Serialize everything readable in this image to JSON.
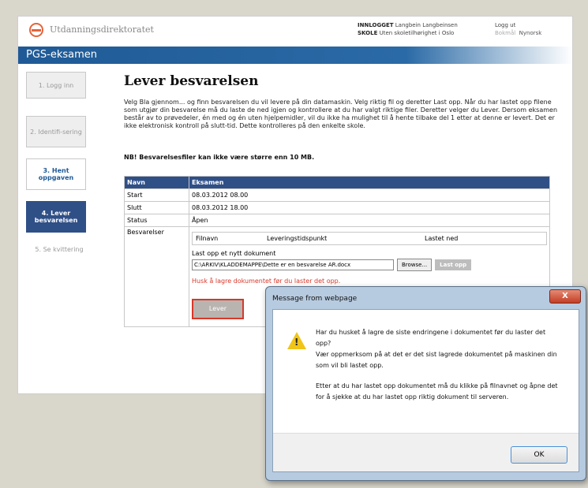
{
  "header": {
    "logo_text": "Utdanningsdirektoratet",
    "logged_in_label": "INNLOGGET",
    "logged_in_user": "Langbein Langbeinsen",
    "school_label": "SKOLE",
    "school_value": "Uten skoletilhørighet i Oslo",
    "logout_link": "Logg ut",
    "bokmal_link": "Bokmål",
    "nynorsk_link": "Nynorsk"
  },
  "banner": {
    "title": "PGS-eksamen"
  },
  "steps": [
    {
      "label": "1. Logg inn"
    },
    {
      "label": "2. Identifi-sering"
    },
    {
      "label": "3. Hent oppgaven"
    },
    {
      "label": "4. Lever besvarelsen"
    },
    {
      "label": "5. Se kvittering"
    }
  ],
  "main": {
    "title": "Lever besvarelsen",
    "intro": "Velg Bla gjennom... og finn besvarelsen du vil levere på din datamaskin. Velg riktig fil og deretter Last opp. Når du har lastet opp filene som utgjør din besvarelse må du laste de ned igjen og kontrollere at du har valgt riktige filer. Deretter velger du Lever. Dersom eksamen består av to prøvedeler, én med og én uten hjelpemidler, vil du ikke ha mulighet til å hente tilbake del 1 etter at denne er levert. Det er ikke elektronisk kontroll på slutt-tid. Dette kontrolleres på den enkelte skole.",
    "nb_warning": "NB! Besvarelsesfiler kan ikke være større enn 10 MB.",
    "table": {
      "header_col1": "Navn",
      "header_col2": "Eksamen",
      "rows": [
        {
          "label": "Start",
          "value": "08.03.2012 08.00"
        },
        {
          "label": "Slutt",
          "value": "08.03.2012 18.00"
        },
        {
          "label": "Status",
          "value": "Åpen"
        }
      ],
      "answers_label": "Besvarelser",
      "subtable_headers": [
        "Filnavn",
        "Leveringstidspunkt",
        "Lastet ned"
      ],
      "upload_label": "Last opp et nytt dokument",
      "file_path": "C:\\ARKIV\\KLADDEMAPPE\\Dette er en besvarelse  AR.docx",
      "browse_label": "Browse...",
      "upload_button": "Last opp",
      "save_reminder": "Husk å lagre dokumentet før du laster det opp.",
      "deliver_button": "Lever"
    }
  },
  "dialog": {
    "title": "Message from webpage",
    "close_label": "X",
    "line1": "Har du husket å lagre de siste endringene i dokumentet før du laster det opp?",
    "line2": "Vær oppmerksom på at det er det sist lagrede dokumentet på maskinen din som vil bli lastet opp.",
    "line3": "Etter at du har lastet opp dokumentet må du klikke på filnavnet og åpne det for å sjekke at du har lastet opp riktig dokument til serveren.",
    "ok_label": "OK"
  },
  "colors": {
    "banner": "#1f5a96",
    "active_step": "#2f4f87",
    "warning_red": "#d8382a"
  }
}
